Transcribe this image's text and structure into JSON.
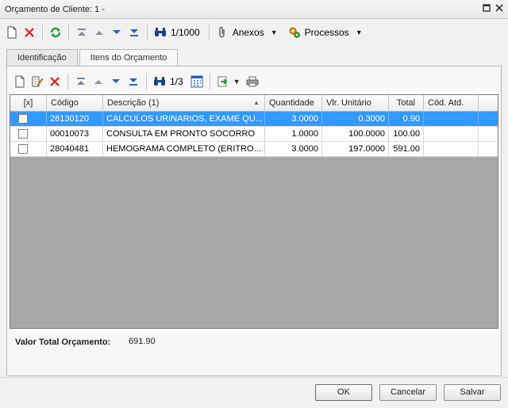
{
  "window": {
    "title": "Orçamento de Cliente: 1 -"
  },
  "toolbar": {
    "record_counter": "1/1000",
    "anexos_label": "Anexos",
    "processos_label": "Processos"
  },
  "tabs": [
    {
      "label": "Identificação"
    },
    {
      "label": "Itens do Orçamento"
    }
  ],
  "sub_toolbar": {
    "record_counter": "1/3"
  },
  "grid": {
    "columns": [
      "[x]",
      "Código",
      "Descrição (1)",
      "Quantidade",
      "Vlr. Unitário",
      "Total",
      "Cód. Atd."
    ],
    "rows": [
      {
        "codigo": "28130120",
        "descricao": "CALCULOS URINARIOS, EXAME QU...",
        "quantidade": "3.0000",
        "unitario": "0.3000",
        "total": "0.90",
        "cod_atd": ""
      },
      {
        "codigo": "00010073",
        "descricao": "CONSULTA EM PRONTO SOCORRO",
        "quantidade": "1.0000",
        "unitario": "100.0000",
        "total": "100.00",
        "cod_atd": ""
      },
      {
        "codigo": "28040481",
        "descricao": "HEMOGRAMA COMPLETO (ERITRO...",
        "quantidade": "3.0000",
        "unitario": "197.0000",
        "total": "591.00",
        "cod_atd": ""
      }
    ]
  },
  "summary": {
    "label": "Valor Total Orçamento:",
    "value": "691.90"
  },
  "buttons": {
    "ok": "OK",
    "cancelar": "Cancelar",
    "salvar": "Salvar"
  },
  "colors": {
    "selection": "#3399ff",
    "grid_empty": "#a8a8a8"
  }
}
